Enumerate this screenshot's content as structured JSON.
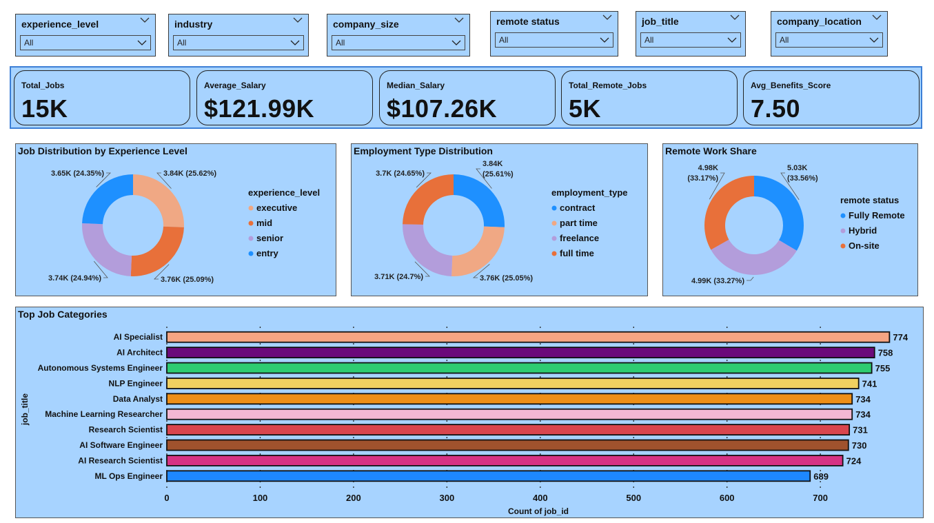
{
  "slicers": [
    {
      "header": "experience_level",
      "value": "All"
    },
    {
      "header": "industry",
      "value": "All"
    },
    {
      "header": "company_size",
      "value": "All"
    },
    {
      "header": "remote status",
      "value": "All"
    },
    {
      "header": "job_title",
      "value": "All"
    },
    {
      "header": "company_location",
      "value": "All"
    }
  ],
  "kpis": [
    {
      "label": "Total_Jobs",
      "value": "15K"
    },
    {
      "label": "Average_Salary",
      "value": "$121.99K"
    },
    {
      "label": "Median_Salary",
      "value": "$107.26K"
    },
    {
      "label": "Total_Remote_Jobs",
      "value": "5K"
    },
    {
      "label": "Avg_Benefits_Score",
      "value": "7.50"
    }
  ],
  "colors": {
    "background": "#a7d3ff",
    "exec_peach": "#f0a884",
    "orange": "#e8703a",
    "lavender": "#b39ddb",
    "blue": "#1e90ff"
  },
  "chart_data": [
    {
      "type": "donut",
      "title": "Job Distribution by Experience Level",
      "legend_title": "experience_level",
      "legend_position": "right",
      "slices": [
        {
          "name": "executive",
          "value": 3.84,
          "label": "3.84K (25.62%)",
          "color": "#f0a884"
        },
        {
          "name": "mid",
          "value": 3.76,
          "label": "3.76K (25.09%)",
          "color": "#e8703a"
        },
        {
          "name": "senior",
          "value": 3.74,
          "label": "3.74K (24.94%)",
          "color": "#b39ddb"
        },
        {
          "name": "entry",
          "value": 3.65,
          "label": "3.65K (24.35%)",
          "color": "#1e90ff"
        }
      ]
    },
    {
      "type": "donut",
      "title": "Employment Type Distribution",
      "legend_title": "employment_type",
      "legend_position": "right",
      "slices": [
        {
          "name": "contract",
          "value": 3.84,
          "label": [
            "3.84K",
            "(25.61%)"
          ],
          "color": "#1e90ff"
        },
        {
          "name": "part time",
          "value": 3.76,
          "label": "3.76K (25.05%)",
          "color": "#f0a884"
        },
        {
          "name": "freelance",
          "value": 3.71,
          "label": "3.71K (24.7%)",
          "color": "#b39ddb"
        },
        {
          "name": "full time",
          "value": 3.7,
          "label": "3.7K (24.65%)",
          "color": "#e8703a"
        }
      ]
    },
    {
      "type": "donut",
      "title": "Remote Work Share",
      "legend_title": "remote status",
      "legend_position": "right",
      "slices": [
        {
          "name": "Fully Remote",
          "value": 5.03,
          "label": [
            "5.03K",
            "(33.56%)"
          ],
          "color": "#1e90ff"
        },
        {
          "name": "Hybrid",
          "value": 4.99,
          "label": "4.99K (33.27%)",
          "color": "#b39ddb"
        },
        {
          "name": "On-site",
          "value": 4.98,
          "label": [
            "4.98K",
            "(33.17%)"
          ],
          "color": "#e8703a"
        }
      ]
    },
    {
      "type": "bar",
      "orientation": "horizontal",
      "title": "Top Job Categories",
      "xlabel": "Count of job_id",
      "ylabel": "job_title",
      "xlim": [
        0,
        774
      ],
      "xticks": [
        0,
        100,
        200,
        300,
        400,
        500,
        600,
        700
      ],
      "grid": true,
      "categories": [
        "AI Specialist",
        "AI Architect",
        "Autonomous Systems Engineer",
        "NLP Engineer",
        "Data Analyst",
        "Machine Learning Researcher",
        "Research Scientist",
        "AI Software Engineer",
        "AI Research Scientist",
        "ML Ops Engineer"
      ],
      "values": [
        774,
        758,
        755,
        741,
        734,
        734,
        731,
        730,
        724,
        689
      ],
      "colors": [
        "#f5a583",
        "#6b0a7a",
        "#2ecc71",
        "#f0d060",
        "#ee8f17",
        "#f3b7d3",
        "#d9464e",
        "#a0522d",
        "#d63384",
        "#1e88ff"
      ]
    }
  ]
}
